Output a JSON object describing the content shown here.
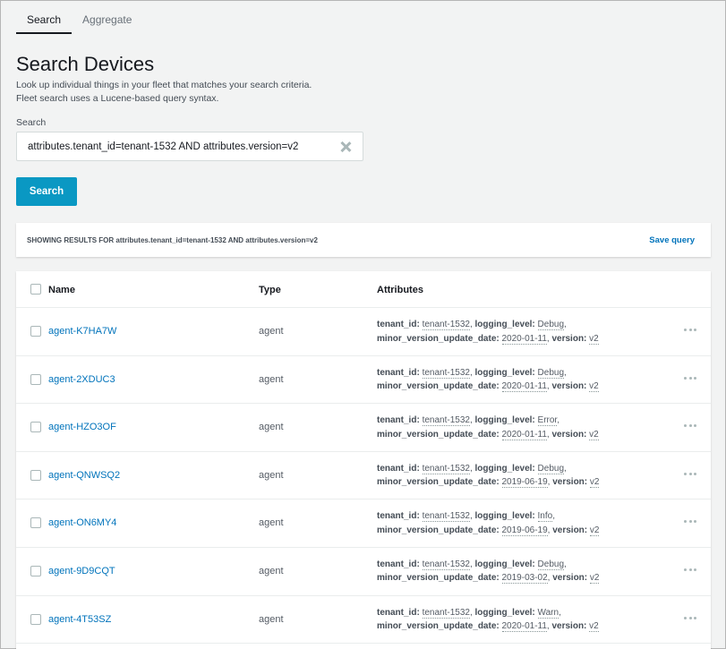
{
  "tabs": [
    {
      "label": "Search",
      "active": true
    },
    {
      "label": "Aggregate",
      "active": false
    }
  ],
  "page": {
    "title": "Search Devices",
    "description_line1": "Look up individual things in your fleet that matches your search criteria.",
    "description_line2": "Fleet search uses a Lucene-based query syntax."
  },
  "search": {
    "label": "Search",
    "value": "attributes.tenant_id=tenant-1532 AND attributes.version=v2",
    "button_label": "Search"
  },
  "results": {
    "summary": "SHOWING RESULTS FOR attributes.tenant_id=tenant-1532 AND attributes.version=v2",
    "save_query_label": "Save query"
  },
  "table": {
    "headers": {
      "name": "Name",
      "type": "Type",
      "attributes": "Attributes"
    },
    "attr_labels": {
      "tenant_id": "tenant_id:",
      "logging_level": "logging_level:",
      "minor_version_update_date": "minor_version_update_date:",
      "version": "version:"
    },
    "rows": [
      {
        "name": "agent-K7HA7W",
        "type": "agent",
        "tenant_id": "tenant-1532",
        "logging_level": "Debug",
        "date": "2020-01-11",
        "version": "v2"
      },
      {
        "name": "agent-2XDUC3",
        "type": "agent",
        "tenant_id": "tenant-1532",
        "logging_level": "Debug",
        "date": "2020-01-11",
        "version": "v2"
      },
      {
        "name": "agent-HZO3OF",
        "type": "agent",
        "tenant_id": "tenant-1532",
        "logging_level": "Error",
        "date": "2020-01-11",
        "version": "v2"
      },
      {
        "name": "agent-QNWSQ2",
        "type": "agent",
        "tenant_id": "tenant-1532",
        "logging_level": "Debug",
        "date": "2019-06-19",
        "version": "v2"
      },
      {
        "name": "agent-ON6MY4",
        "type": "agent",
        "tenant_id": "tenant-1532",
        "logging_level": "Info",
        "date": "2019-06-19",
        "version": "v2"
      },
      {
        "name": "agent-9D9CQT",
        "type": "agent",
        "tenant_id": "tenant-1532",
        "logging_level": "Debug",
        "date": "2019-03-02",
        "version": "v2"
      },
      {
        "name": "agent-4T53SZ",
        "type": "agent",
        "tenant_id": "tenant-1532",
        "logging_level": "Warn",
        "date": "2020-01-11",
        "version": "v2"
      }
    ]
  }
}
